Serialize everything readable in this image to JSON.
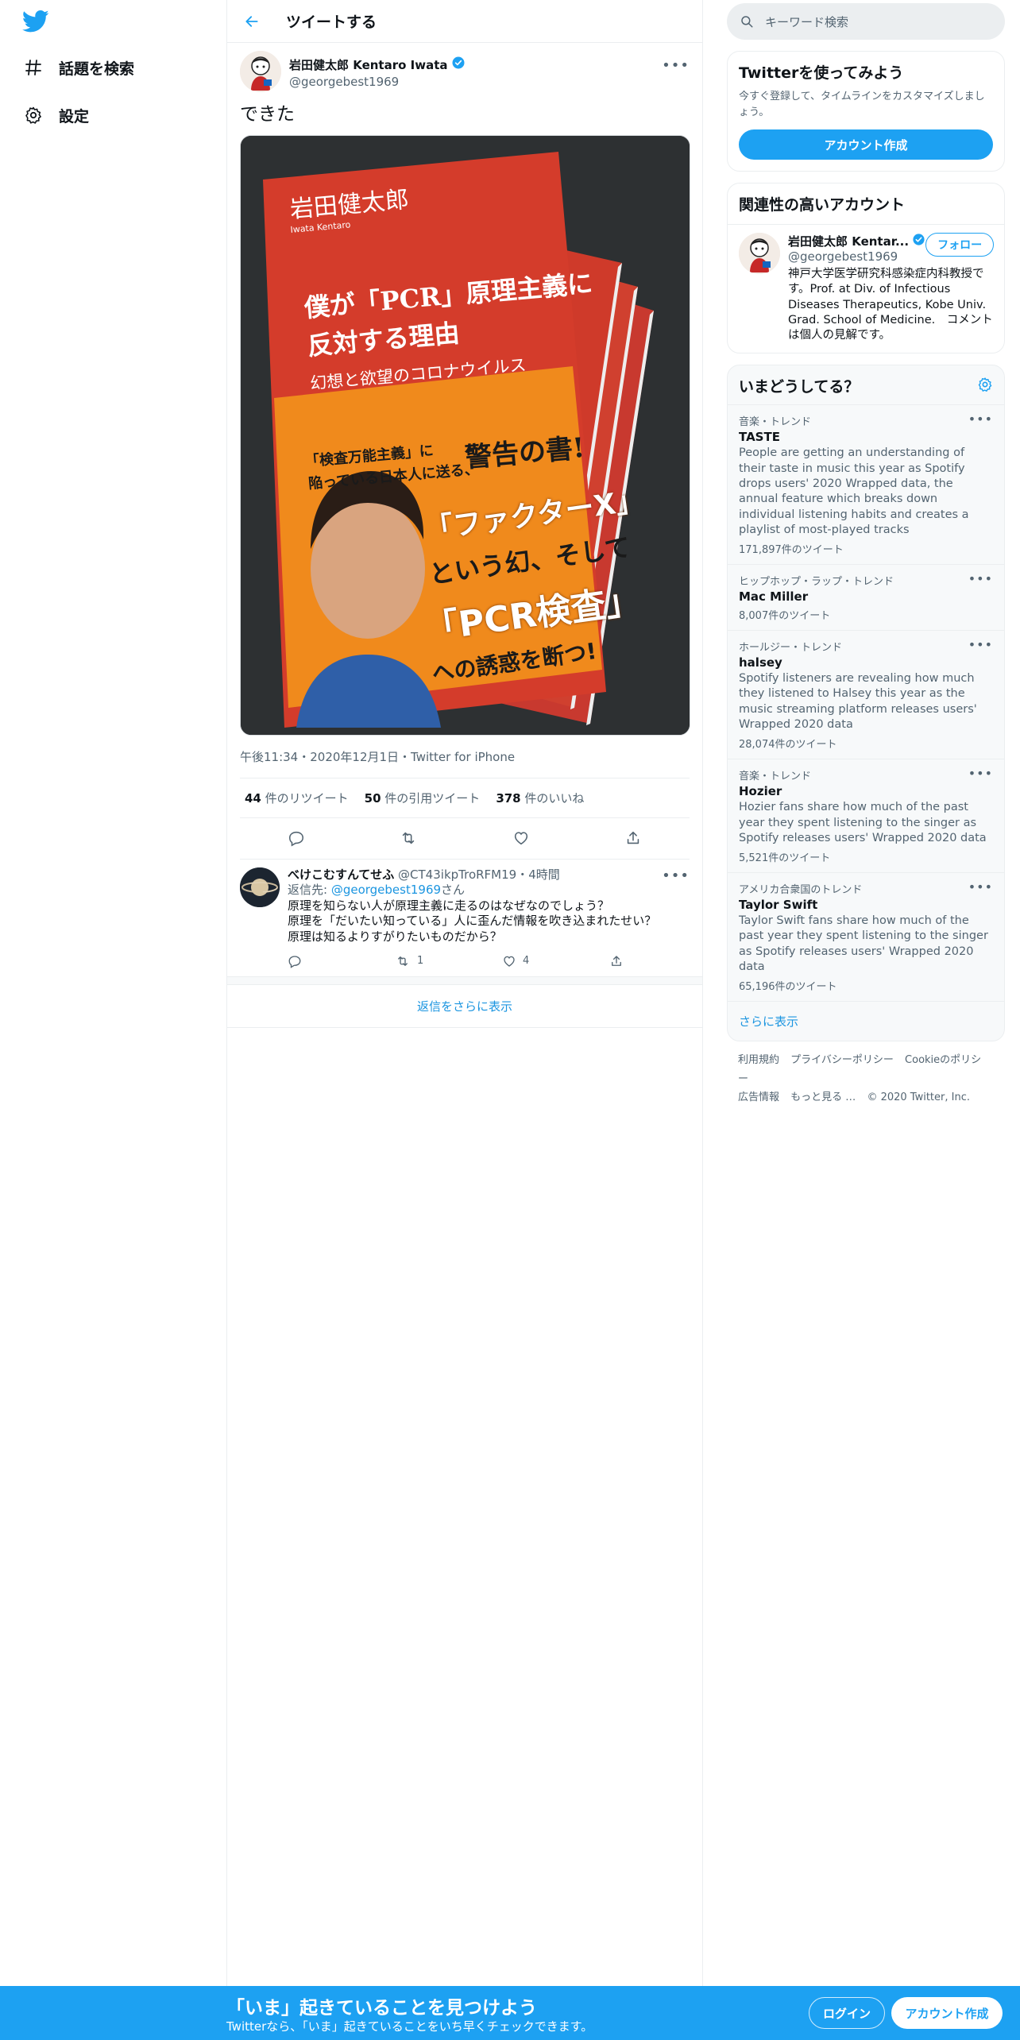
{
  "colors": {
    "accent": "#1da1f2",
    "link": "#1b95e0",
    "text": "#0f1419",
    "muted": "#536471",
    "border": "#ebeef0"
  },
  "nav": {
    "logo_icon": "twitter-bird-icon",
    "items": [
      {
        "label": "話題を検索",
        "icon": "hashtag-icon"
      },
      {
        "label": "設定",
        "icon": "gear-icon"
      }
    ]
  },
  "header": {
    "title": "ツイートする",
    "back_icon": "back-arrow-icon"
  },
  "tweet": {
    "author_name": "岩田健太郎 Kentaro Iwata",
    "handle": "@georgebest1969",
    "text": "できた",
    "media": {
      "author_jp": "岩田健太郎",
      "author_en": "Iwata Kentaro",
      "title_line1": "僕が「PCR」原理主義に",
      "title_line2": "反対する理由",
      "subtitle": "幻想と欲望のコロナウイルス",
      "band_line1": "「検査万能主義」に",
      "band_line2": "陥っている日本人に送る、",
      "band_big": "警告の書!",
      "headline1": "「ファクターX」",
      "headline2": "という幻、そして",
      "headline3": "「PCR検査」",
      "headline4": "への誘惑を断つ!"
    },
    "meta": "午後11:34・2020年12月1日・Twitter for iPhone",
    "stats": [
      {
        "count": "44",
        "label": " 件のリツイート"
      },
      {
        "count": "50",
        "label": " 件の引用ツイート"
      },
      {
        "count": "378",
        "label": " 件のいいね"
      }
    ]
  },
  "reply": {
    "name": "べけこむすんてせふ",
    "handle": "@CT43ikpTroRFM19",
    "time": "・4時間",
    "to_prefix": "返信先: ",
    "to_handle": "@georgebest1969",
    "to_suffix": "さん",
    "lines": [
      "原理を知らない人が原理主義に走るのはなぜなのでしょう？",
      "原理を「だいたい知っている」人に歪んだ情報を吹き込まれたせい？",
      "原理は知るよりすがりたいものだから？"
    ],
    "retweets": "1",
    "likes": "4"
  },
  "show_more": "返信をさらに表示",
  "right": {
    "search_placeholder": "キーワード検索",
    "signup": {
      "title": "Twitterを使ってみよう",
      "desc": "今すぐ登録して、タイムラインをカスタマイズしましょう。",
      "button": "アカウント作成"
    },
    "related": {
      "title": "関連性の高いアカウント",
      "name": "岩田健太郎 Kentar...",
      "handle": "@georgebest1969",
      "follow": "フォロー",
      "bio": "神戸大学医学研究科感染症内科教授です。Prof. at Div. of Infectious Diseases Therapeutics, Kobe Univ. Grad. School of Medicine.　コメントは個人の見解です。"
    },
    "trends": {
      "title": "いまどうしてる？",
      "items": [
        {
          "cat": "音楽・トレンド",
          "name": "TASTE",
          "desc": "People are getting an understanding of their taste in music this year as Spotify drops users' 2020 Wrapped data, the annual feature which breaks down individual listening habits and creates a playlist of most-played tracks",
          "count": "171,897件のツイート"
        },
        {
          "cat": "ヒップホップ・ラップ・トレンド",
          "name": "Mac Miller",
          "desc": "",
          "count": "8,007件のツイート"
        },
        {
          "cat": "ホールジー・トレンド",
          "name": "halsey",
          "desc": "Spotify listeners are revealing how much they listened to Halsey this year as the music streaming platform releases users' Wrapped 2020 data",
          "count": "28,074件のツイート"
        },
        {
          "cat": "音楽・トレンド",
          "name": "Hozier",
          "desc": "Hozier fans share how much of the past year they spent listening to the singer as Spotify releases users' Wrapped 2020 data",
          "count": "5,521件のツイート"
        },
        {
          "cat": "アメリカ合衆国のトレンド",
          "name": "Taylor Swift",
          "desc": "Taylor Swift fans share how much of the past year they spent listening to the singer as Spotify releases users' Wrapped 2020 data",
          "count": "65,196件のツイート"
        }
      ],
      "more": "さらに表示"
    },
    "footer": [
      "利用規約",
      "プライバシーポリシー",
      "Cookieのポリシー",
      "広告情報",
      "もっと見る …",
      "© 2020 Twitter, Inc."
    ]
  },
  "bottom": {
    "title": "「いま」起きていることを見つけよう",
    "subtitle": "Twitterなら、「いま」起きていることをいち早くチェックできます。",
    "login": "ログイン",
    "signup": "アカウント作成"
  }
}
